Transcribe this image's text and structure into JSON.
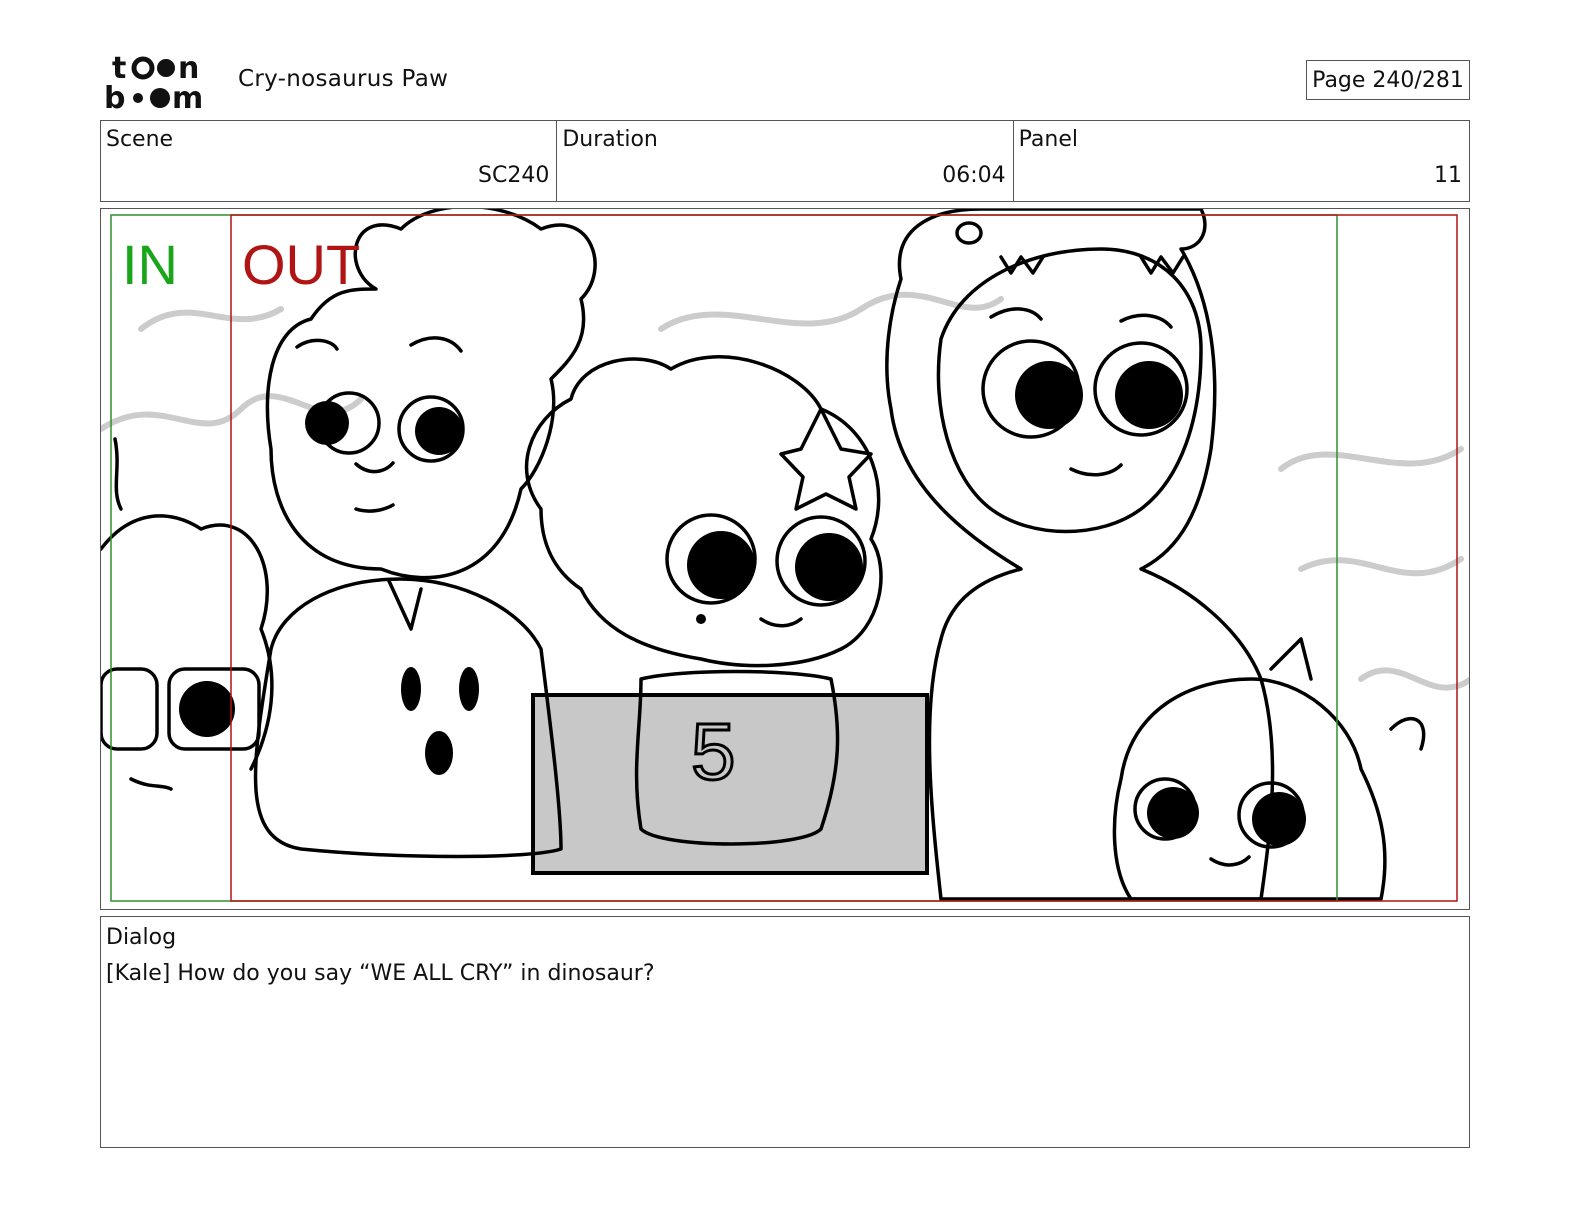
{
  "header": {
    "logo_text": "toon boom",
    "project_title": "Cry-nosaurus Paw",
    "page_label": "Page 240/281"
  },
  "info": {
    "scene_label": "Scene",
    "scene_value": "SC240",
    "duration_label": "Duration",
    "duration_value": "06:04",
    "panel_label": "Panel",
    "panel_value": "11"
  },
  "panel": {
    "in_label": "IN",
    "out_label": "OUT",
    "in_color": "#1aa51a",
    "out_color": "#b01414",
    "shirt_number": "5"
  },
  "dialog": {
    "label": "Dialog",
    "text": "[Kale] How do you say “WE ALL CRY” in dinosaur?"
  }
}
